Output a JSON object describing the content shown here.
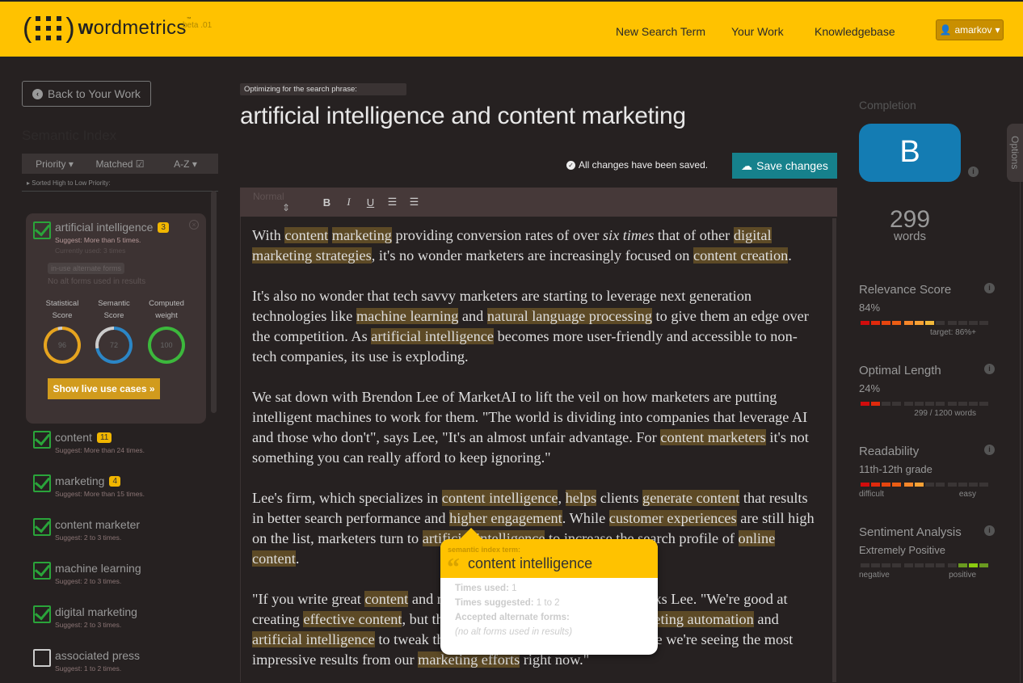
{
  "header": {
    "brand_bold": "w",
    "brand_rest": "ordmetrics",
    "tm": "™",
    "beta": "beta .01",
    "nav": [
      "New Search Term",
      "Your Work",
      "Knowledgebase"
    ],
    "user": "amarkov",
    "brand_color": "#FFC200"
  },
  "sidebar": {
    "back": "Back to Your Work",
    "heading": "Semantic Index",
    "sort": {
      "priority": "Priority",
      "matched": "Matched",
      "az": "A-Z"
    },
    "sorted_label": "Sorted High to Low Priority:",
    "expanded": {
      "term": "artificial intelligence",
      "count": "3",
      "suggest": "Suggest: More than 5 times.",
      "current": "Currently used: 3 times",
      "alt_label": "in-use alternate forms",
      "alt_none": "No alt forms used in results",
      "scores": [
        {
          "label1": "Statistical",
          "label2": "Score",
          "value": 96,
          "text": "96",
          "color": "#e6a41f"
        },
        {
          "label1": "Semantic",
          "label2": "Score",
          "value": 72,
          "text": "72",
          "color": "#2b86c6"
        },
        {
          "label1": "Computed",
          "label2": "weight",
          "value": 100,
          "text": "100",
          "color": "#3cb83c"
        }
      ],
      "live_button": "Show live use cases »"
    },
    "terms": [
      {
        "term": "content",
        "count": "11",
        "suggest": "Suggest: More than 24 times.",
        "checked": true
      },
      {
        "term": "marketing",
        "count": "4",
        "suggest": "Suggest: More than 15 times.",
        "checked": true
      },
      {
        "term": "content marketer",
        "suggest": "Suggest: 2 to 3 times.",
        "checked": true
      },
      {
        "term": "machine learning",
        "suggest": "Suggest: 2 to 3 times.",
        "checked": true
      },
      {
        "term": "digital marketing",
        "suggest": "Suggest: 2 to 3 times.",
        "checked": true
      },
      {
        "term": "associated press",
        "suggest": "Suggest: 1 to 2 times.",
        "checked": false
      }
    ]
  },
  "main": {
    "phrase_label": "Optimizing for the search phrase:",
    "phrase": "artificial intelligence and content marketing",
    "saved": "All changes have been saved.",
    "save_button": "Save changes",
    "toolbar": {
      "format": "Normal",
      "bold": "B",
      "italic": "I",
      "underline": "U"
    },
    "paragraphs": [
      [
        [
          "With "
        ],
        [
          "content",
          1
        ],
        [
          " "
        ],
        [
          "marketing",
          1
        ],
        [
          " providing conversion rates of over "
        ],
        [
          "six times",
          0,
          1
        ],
        [
          " that of other "
        ],
        [
          "digital marketing strategies",
          1
        ],
        [
          ", it's no wonder marketers are increasingly focused on "
        ],
        [
          "content creation",
          1
        ],
        [
          "."
        ]
      ],
      [
        [
          "It's also no wonder that tech savvy marketers are starting to leverage next generation technologies like "
        ],
        [
          "machine learning",
          1
        ],
        [
          " and "
        ],
        [
          "natural language processing",
          1
        ],
        [
          " to give them an edge over the competition.  As "
        ],
        [
          "artificial intelligence",
          1
        ],
        [
          " becomes more user-friendly and accessible to non-tech companies, its use is exploding."
        ]
      ],
      [
        [
          "We sat down with Brendon Lee of MarketAI to lift the veil on how marketers are putting intelligent machines to work for them. \"The world is dividing into companies that leverage AI and those who don't\", says Lee,  \"It's an almost unfair advantage. For "
        ],
        [
          "content marketers",
          1
        ],
        [
          " it's not something you can really afford to keep ignoring.\""
        ]
      ],
      [
        [
          "Lee's firm, which specializes in "
        ],
        [
          "content intelligence",
          1
        ],
        [
          ", "
        ],
        [
          "helps",
          1
        ],
        [
          " clients "
        ],
        [
          "generate content",
          1
        ],
        [
          " that results in better search performance and "
        ],
        [
          "higher engagement",
          1
        ],
        [
          ". While "
        ],
        [
          "customer experiences",
          1
        ],
        [
          " are still high on the list, marketers turn to "
        ],
        [
          "artificial intelligence",
          1
        ],
        [
          " to increase the search profile of "
        ],
        [
          "online content",
          1
        ],
        [
          "."
        ]
      ],
      [
        [
          "\"If you write great "
        ],
        [
          "content",
          1
        ],
        [
          " and nobody sees it, what's the point?\", asks Lee. \"We're good at creating "
        ],
        [
          "effective content",
          1
        ],
        [
          ", but that's only half the battle. Using "
        ],
        [
          "marketing automation",
          1
        ],
        [
          " and "
        ],
        [
          "artificial intelligence",
          1
        ],
        [
          " to tweak the "
        ],
        [
          "content",
          1
        ],
        [
          " for "
        ],
        [
          "search engines",
          1
        ],
        [
          " is where we're seeing the most impressive results from our "
        ],
        [
          "marketing efforts",
          1
        ],
        [
          " right now.\""
        ]
      ]
    ],
    "tooltip": {
      "label": "semantic index term:",
      "term": "content intelligence",
      "used_label": "Times used:",
      "used": "1",
      "suggested_label": "Times suggested:",
      "suggested": "1 to 2",
      "alt_label": "Accepted alternate forms:",
      "alt_none": "(no alt forms used in results)"
    }
  },
  "right": {
    "completion_label": "Completion",
    "grade": "B",
    "grade_color": "#147cb3",
    "options": "Options",
    "word_count": "299",
    "words_label": "words",
    "metrics": [
      {
        "title": "Relevance Score",
        "value": "84%",
        "lit": 7,
        "total": 12,
        "cap_right": "target: 86%+",
        "cap_left": ""
      },
      {
        "title": "Optimal Length",
        "value": "24%",
        "lit": 2,
        "total": 12,
        "cap_right": "299 / 1200 words",
        "cap_left": ""
      },
      {
        "title": "Readability",
        "value": "11th-12th  grade",
        "lit": 6,
        "total": 12,
        "cap_left": "difficult",
        "cap_right": "easy"
      },
      {
        "title": "Sentiment Analysis",
        "value": "Extremely Positive",
        "lit": 3,
        "total": 12,
        "from_right": true,
        "cap_left": "negative",
        "cap_right": "positive"
      }
    ]
  }
}
